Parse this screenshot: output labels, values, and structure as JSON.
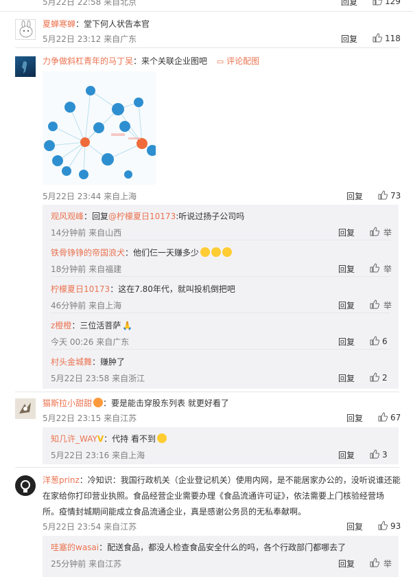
{
  "top_partial": {
    "time": "5月22日 22:58 来自北京",
    "reply": "回复",
    "likes": "129"
  },
  "comments": [
    {
      "user": "夏蝉寒蝉",
      "text": "：堂下何人状告本官",
      "time": "5月22日 23:12 来自广东",
      "reply": "回复",
      "likes": "118"
    },
    {
      "user": "力争做斜杠青年的马丁吴",
      "text": "：来个关联企业图吧",
      "extra": "评论配图",
      "time": "5月22日 23:44 来自上海",
      "reply": "回复",
      "likes": "73",
      "subs": [
        {
          "user": "观风观峰",
          "text": "：回复",
          "mention": "@柠檬夏日10173",
          "text2": ":听说过扬子公司吗",
          "time": "14分钟前 来自山西",
          "reply": "回复",
          "likes": "",
          "flag": "举"
        },
        {
          "user": "铁骨铮铮的帝国浪犬",
          "text": "：他们仨一天赚多少",
          "time": "18分钟前 来自福建",
          "reply": "回复",
          "likes": "",
          "flag": "举"
        },
        {
          "user": "柠檬夏日10173",
          "text": "：这在7.80年代，就叫投机倒把吧",
          "time": "46分钟前 来自上海",
          "reply": "回复",
          "likes": "",
          "flag": "举"
        },
        {
          "user": "z橙橙",
          "text": "：三位活菩萨",
          "time": "今天 00:26 来自广东",
          "reply": "回复",
          "likes": "6"
        },
        {
          "user": "村头金城舞",
          "text": "：赚肿了",
          "time": "5月22日 23:58 来自浙江",
          "reply": "回复",
          "likes": "2"
        }
      ]
    },
    {
      "user": "猫斯拉小甜甜",
      "text": "：要是能击穿股东列表 就更好看了",
      "time": "5月22日 23:15 来自江苏",
      "reply": "回复",
      "likes": "67",
      "subs": [
        {
          "user": "知几许_WAY",
          "badge": "V",
          "text": "：代持 看不到",
          "time": "5月22日 23:16 来自上海",
          "reply": "回复",
          "likes": "3"
        }
      ]
    },
    {
      "user": "洋葱prinz",
      "text": "：冷知识：我国行政机关（企业登记机关）使用内网，是不能居家办公的，没听说谁还能",
      "text_l2": "在家给你打印营业执照。食品经营企业需要办理《食品流通许可证》，依法需要上门核验经营场",
      "text_l3": "所。疫情封城期间能成立食品流通企业，真是感谢公务员的无私奉献啊。",
      "time": "5月22日 23:54 来自江苏",
      "reply": "回复",
      "likes": "93",
      "subs": [
        {
          "user": "哇塞的wasai",
          "text": "：配送食品，都没人检查食品安全什么的吗，各个行政部门都哪去了",
          "time": "25分钟前 来自江苏",
          "reply": "回复",
          "likes": "",
          "flag": "举"
        }
      ]
    }
  ],
  "colors": {
    "name": "#eb7350",
    "meta": "#808080",
    "subbg": "#f2f2f5",
    "divider": "#e6e6e6"
  }
}
